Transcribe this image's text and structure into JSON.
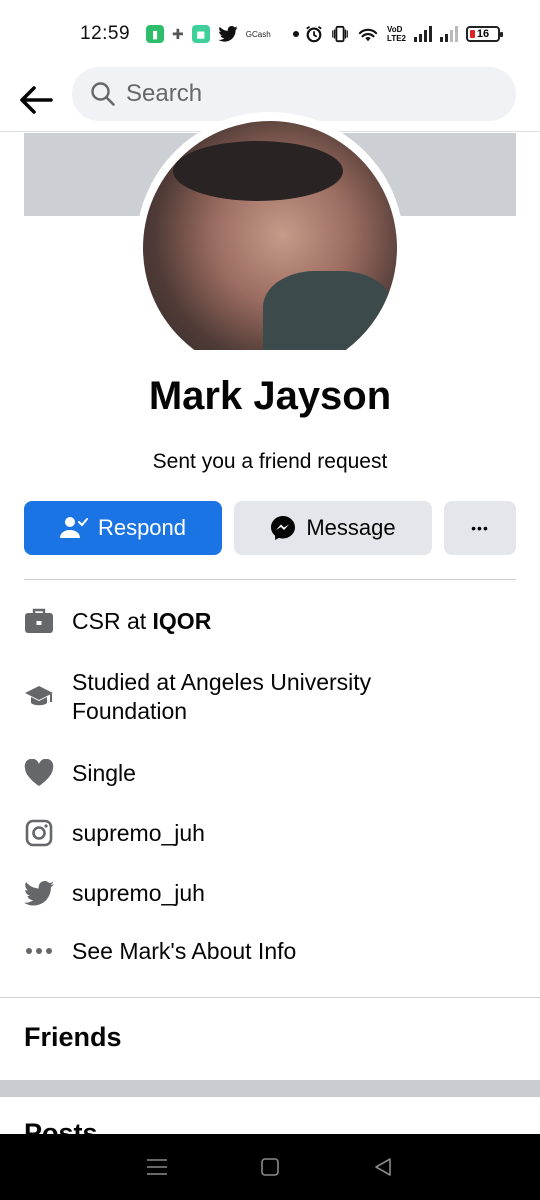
{
  "status_bar": {
    "time": "12:59",
    "gcash_label": "GCash",
    "volte_top": "VoD",
    "volte_bottom": "LTE2",
    "battery": "16"
  },
  "search": {
    "placeholder": "Search"
  },
  "profile": {
    "name": "Mark Jayson",
    "subtitle": "Sent you a friend request"
  },
  "actions": {
    "respond_label": "Respond",
    "message_label": "Message",
    "more_label": "•••"
  },
  "info": {
    "work_prefix": "CSR at ",
    "work_place": "IQOR",
    "education": "Studied at Angeles University Foundation",
    "relationship": "Single",
    "instagram": "supremo_juh",
    "twitter": "supremo_juh",
    "about_link": "See Mark's About Info"
  },
  "sections": {
    "friends": "Friends",
    "posts": "Posts"
  },
  "colors": {
    "accent": "#1b74e4",
    "secondary_button": "#e4e6eb",
    "icon_gray": "#65676b"
  }
}
